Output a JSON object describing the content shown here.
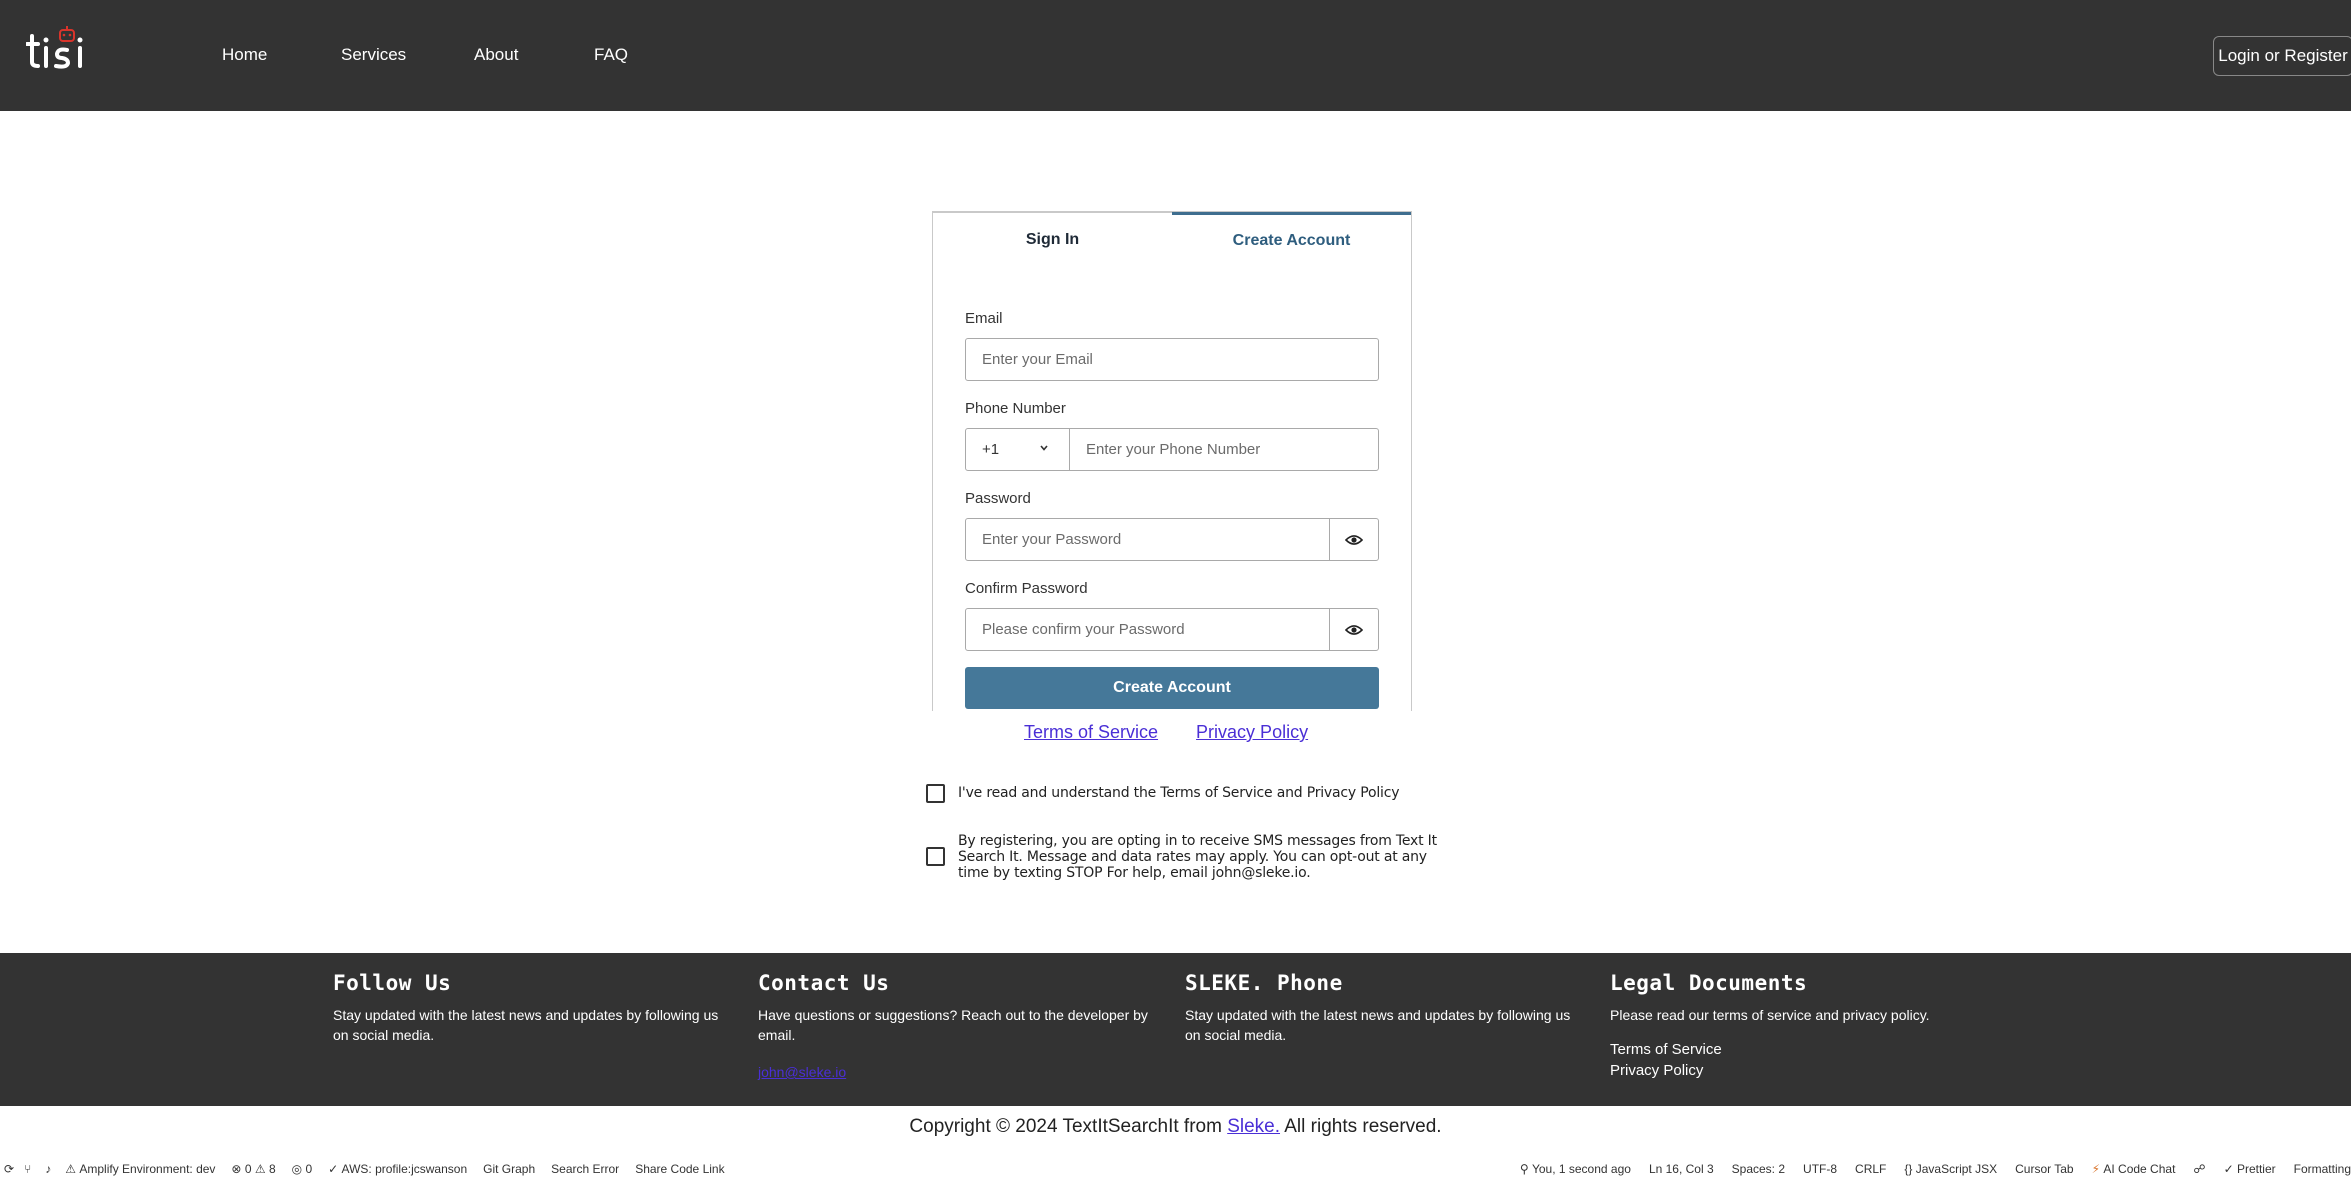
{
  "header": {
    "logo_text": "tisi",
    "nav": [
      "Home",
      "Services",
      "About",
      "FAQ"
    ],
    "login_label": "Login or Register"
  },
  "auth": {
    "tabs": {
      "sign_in": "Sign In",
      "create_account": "Create Account"
    },
    "active_tab": "Create Account",
    "email": {
      "label": "Email",
      "placeholder": "Enter your Email"
    },
    "phone": {
      "label": "Phone Number",
      "code": "+1",
      "placeholder": "Enter your Phone Number"
    },
    "password": {
      "label": "Password",
      "placeholder": "Enter your Password"
    },
    "confirm_password": {
      "label": "Confirm Password",
      "placeholder": "Please confirm your Password"
    },
    "submit_label": "Create Account"
  },
  "links": {
    "terms": "Terms of Service",
    "privacy": "Privacy Policy"
  },
  "checkboxes": {
    "agree": "I've read and understand the Terms of Service and Privacy Policy",
    "sms_line1": "By registering, you are opting in to receive SMS messages from Text It",
    "sms_line2": "Search It. Message and data rates may apply. You can opt-out at any",
    "sms_line3": "time by texting STOP For help, email john@sleke.io."
  },
  "footer": {
    "follow": {
      "title": "Follow Us",
      "line1": "Stay updated with the latest news and updates by following us",
      "line2": "on social media."
    },
    "contact": {
      "title": "Contact Us",
      "line1": "Have questions or suggestions? Reach out to the developer by",
      "line2": "email.",
      "email": "john@sleke.io"
    },
    "phone": {
      "title": "SLEKE. Phone",
      "line1": "Stay updated with the latest news and updates by following us",
      "line2": "on social media."
    },
    "legal": {
      "title": "Legal Documents",
      "text": "Please read our terms of service and privacy policy.",
      "terms": "Terms of Service",
      "privacy": "Privacy Policy"
    }
  },
  "copyright": {
    "prefix": "Copyright © 2024 TextItSearchIt from ",
    "link": "Sleke.",
    "suffix": " All rights reserved."
  },
  "statusbar": {
    "left": [
      "Amplify Environment: dev",
      "0",
      "8",
      "0",
      "AWS: profile:jcswanson",
      "Git Graph",
      "Search Error",
      "Share Code Link"
    ],
    "right": [
      "You, 1 second ago",
      "Ln 16, Col 3",
      "Spaces: 2",
      "UTF-8",
      "CRLF",
      "JavaScript JSX",
      "Cursor Tab",
      "AI Code Chat",
      "Prettier",
      "Formatting"
    ]
  },
  "colors": {
    "header_bg": "#333333",
    "accent": "#457899",
    "tab_active": "#3f6e8f",
    "link": "#4a2fd6"
  }
}
